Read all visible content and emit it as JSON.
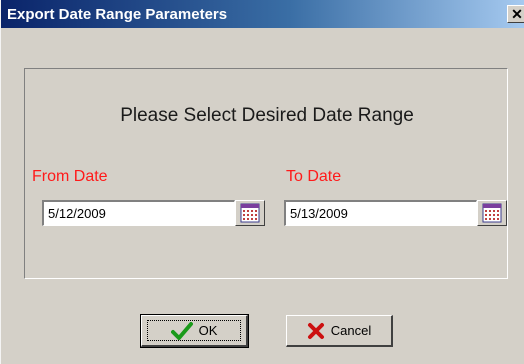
{
  "window": {
    "title": "Export Date Range Parameters",
    "close_glyph": "✕"
  },
  "panel": {
    "prompt": "Please Select Desired Date Range"
  },
  "from_date": {
    "label": "From Date",
    "value": "5/12/2009"
  },
  "to_date": {
    "label": "To Date",
    "value": "5/13/2009"
  },
  "buttons": {
    "ok_label": "OK",
    "cancel_label": "Cancel"
  },
  "colors": {
    "title_gradient_start": "#0a246a",
    "title_gradient_end": "#a6caf0",
    "label_red": "#ff1a1a",
    "dialog_bg": "#d4d0c8",
    "ok_check": "#1a9a1a",
    "cancel_x": "#cc1010"
  },
  "icons": {
    "close": "close-icon",
    "calendar": "calendar-icon",
    "ok": "checkmark-icon",
    "cancel": "x-icon"
  }
}
